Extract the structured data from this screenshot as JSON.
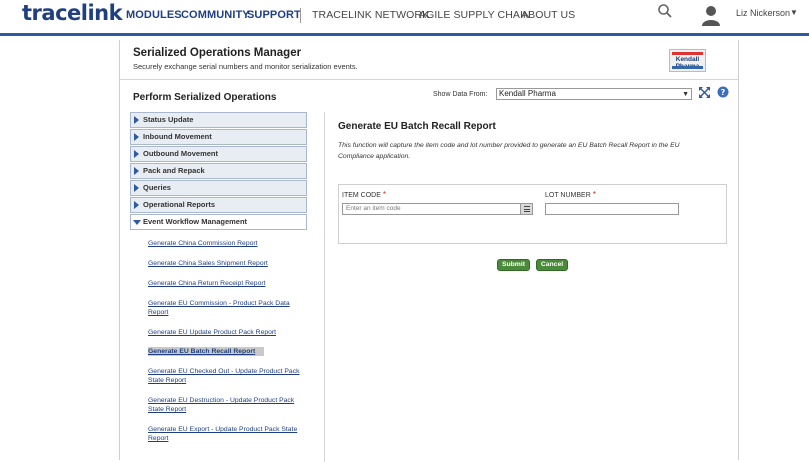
{
  "nav": {
    "logo": "tracelink",
    "items": [
      "MODULES",
      "COMMUNITY",
      "SUPPORT"
    ],
    "secondary": [
      "TRACELINK NETWORK",
      "AGILE SUPPLY CHAIN",
      "ABOUT US"
    ],
    "user_name": "Liz Nickerson"
  },
  "app": {
    "title": "Serialized Operations Manager",
    "subtitle": "Securely exchange serial numbers and monitor serialization events.",
    "brand_logo_text": "Kendall Pharma"
  },
  "operations": {
    "section_title": "Perform Serialized Operations",
    "show_data_label": "Show Data From:",
    "show_data_value": "Kendall Pharma"
  },
  "menu": {
    "items": [
      "Status Update",
      "Inbound Movement",
      "Outbound Movement",
      "Pack and Repack",
      "Queries",
      "Operational Reports",
      "Event Workflow Management"
    ],
    "sub_links": [
      "Generate China Commission Report",
      "Generate China Sales Shipment Report",
      "Generate China Return Receipt Report",
      "Generate EU Commission - Product Pack Data Report",
      "Generate EU Update Product Pack Report",
      "Generate EU Batch Recall Report",
      "Generate EU Checked Out - Update Product Pack State Report",
      "Generate EU Destruction - Update Product Pack State Report",
      "Generate EU Export - Update Product Pack State Report"
    ]
  },
  "report": {
    "title": "Generate EU Batch Recall Report",
    "description": "This function will capture the item code and lot number provided to generate an EU Batch Recall Report in the EU Compliance application.",
    "item_code_label": "ITEM CODE",
    "item_code_placeholder": "Enter an item code",
    "lot_number_label": "LOT NUMBER",
    "required_mark": "*",
    "submit_label": "Submit",
    "cancel_label": "Cancel"
  },
  "colors": {
    "brand_blue": "#1f3f80",
    "nav_underline": "#2d5aa0",
    "button_green": "#4a8a3a",
    "required_red": "#d22222"
  },
  "icons": {
    "search": "search-icon",
    "avatar": "user-avatar-icon",
    "expand": "expand-icon",
    "help": "help-icon"
  }
}
